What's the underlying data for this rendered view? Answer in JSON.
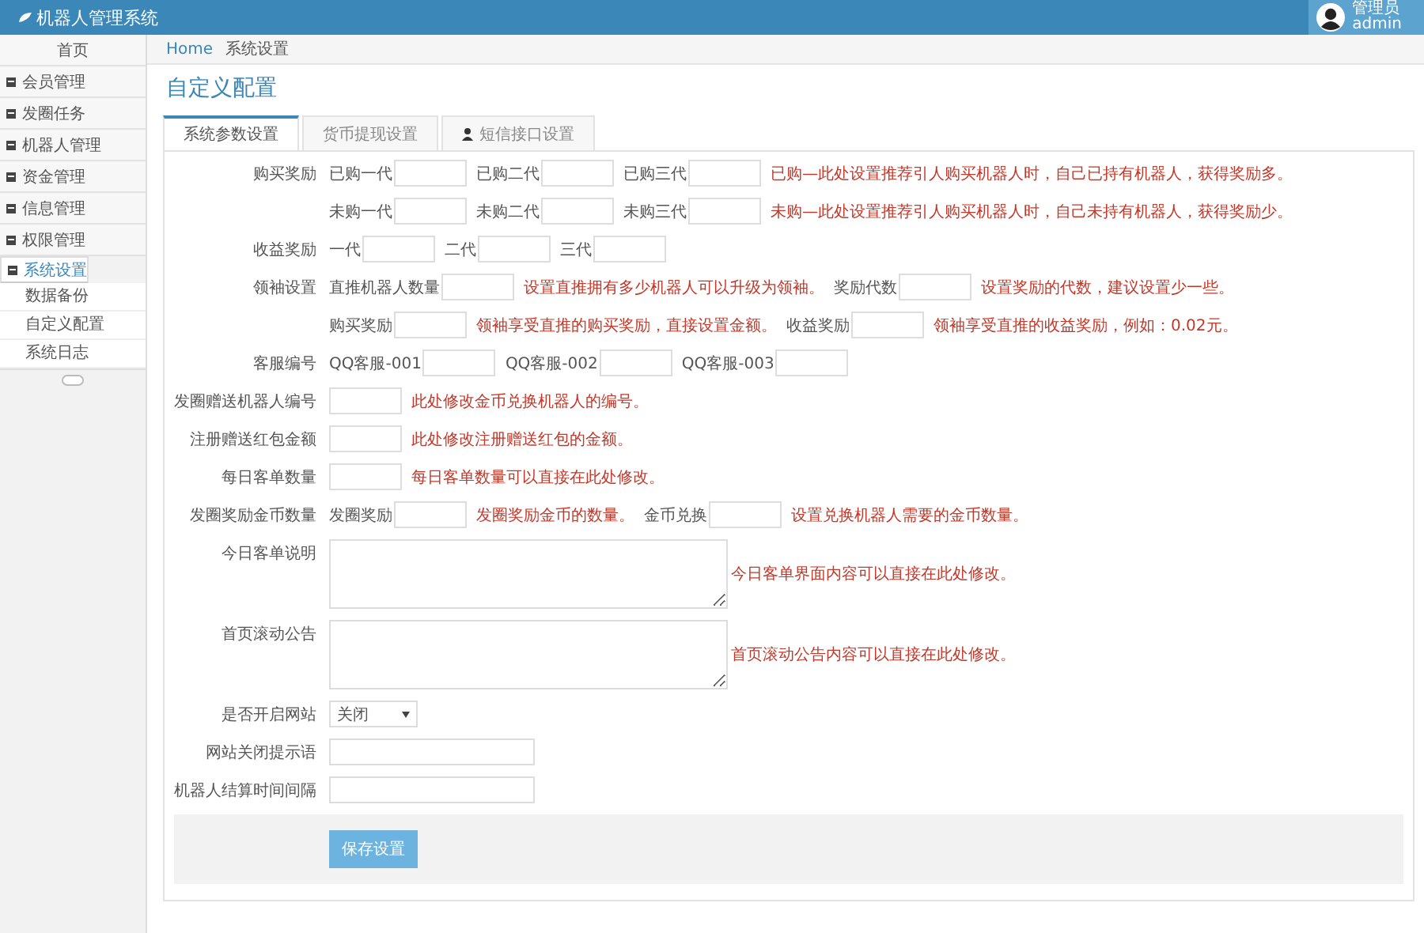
{
  "header": {
    "title": "机器人管理系统",
    "user_role": "管理员",
    "user_name": "admin"
  },
  "sidebar": {
    "items": [
      {
        "label": "首页",
        "selected": false
      },
      {
        "label": "会员管理",
        "selected": false
      },
      {
        "label": "发圈任务",
        "selected": false
      },
      {
        "label": "机器人管理",
        "selected": false
      },
      {
        "label": "资金管理",
        "selected": false
      },
      {
        "label": "信息管理",
        "selected": false
      },
      {
        "label": "权限管理",
        "selected": false
      },
      {
        "label": "系统设置",
        "selected": true,
        "expanded": true,
        "children": [
          {
            "label": "数据备份"
          },
          {
            "label": "自定义配置"
          },
          {
            "label": "系统日志"
          }
        ]
      }
    ]
  },
  "breadcrumb": [
    "Home",
    "系统设置"
  ],
  "page_title": "自定义配置",
  "tabs": [
    {
      "label": "系统参数设置",
      "selected": true
    },
    {
      "label": "货币提现设置",
      "selected": false
    },
    {
      "label": "短信接口设置",
      "selected": false
    }
  ],
  "form": {
    "rows": [
      {
        "label": "购买奖励",
        "kind": "fields",
        "items": [
          {
            "prefix": "已购一代"
          },
          {
            "prefix": "已购二代"
          },
          {
            "prefix": "已购三代",
            "hint": "已购—此处设置推荐引人购买机器人时，自己已持有机器人，获得奖励多。"
          }
        ]
      },
      {
        "kind": "fields",
        "items": [
          {
            "prefix": "未购一代"
          },
          {
            "prefix": "未购二代"
          },
          {
            "prefix": "未购三代",
            "hint": "未购—此处设置推荐引人购买机器人时，自己未持有机器人，获得奖励少。"
          }
        ]
      },
      {
        "label": "收益奖励",
        "kind": "fields",
        "items": [
          {
            "prefix": "一代"
          },
          {
            "prefix": "二代"
          },
          {
            "prefix": "三代"
          }
        ]
      },
      {
        "label": "领袖设置",
        "kind": "fields",
        "items": [
          {
            "prefix": "直推机器人数量",
            "hint": "设置直推拥有多少机器人可以升级为领袖。"
          },
          {
            "prefix": "奖励代数",
            "hint": "设置奖励的代数，建议设置少一些。"
          }
        ]
      },
      {
        "kind": "fields",
        "items": [
          {
            "prefix": "购买奖励",
            "hint": "领袖享受直推的购买奖励，直接设置金额。"
          },
          {
            "prefix": "收益奖励",
            "hint": "领袖享受直推的收益奖励，例如：0.02元。"
          }
        ]
      },
      {
        "label": "客服编号",
        "kind": "fields",
        "items": [
          {
            "prefix": "QQ客服-001"
          },
          {
            "prefix": "QQ客服-002"
          },
          {
            "prefix": "QQ客服-003"
          }
        ]
      },
      {
        "label": "发圈赠送机器人编号",
        "kind": "fields",
        "items": [
          {
            "hint": "此处修改金币兑换机器人的编号。"
          }
        ]
      },
      {
        "label": "注册赠送红包金额",
        "kind": "fields",
        "items": [
          {
            "hint": "此处修改注册赠送红包的金额。"
          }
        ]
      },
      {
        "label": "每日客单数量",
        "kind": "fields",
        "items": [
          {
            "hint": "每日客单数量可以直接在此处修改。"
          }
        ]
      },
      {
        "label": "发圈奖励金币数量",
        "kind": "fields",
        "items": [
          {
            "prefix": "发圈奖励",
            "hint": "发圈奖励金币的数量。"
          },
          {
            "prefix": "金币兑换",
            "hint": "设置兑换机器人需要的金币数量。"
          }
        ]
      },
      {
        "label": "今日客单说明",
        "kind": "textarea",
        "hint": "今日客单界面内容可以直接在此处修改。"
      },
      {
        "label": "首页滚动公告",
        "kind": "textarea",
        "hint": "首页滚动公告内容可以直接在此处修改。"
      },
      {
        "label": "是否开启网站",
        "kind": "select",
        "value": "关闭"
      },
      {
        "label": "网站关闭提示语",
        "kind": "wide"
      },
      {
        "label": "机器人结算时间间隔",
        "kind": "wide"
      }
    ]
  },
  "save_button": "保存设置"
}
